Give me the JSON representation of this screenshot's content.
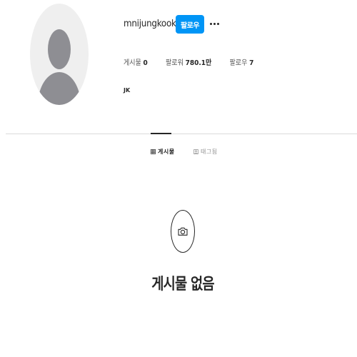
{
  "profile": {
    "username": "mnijungkook",
    "follow_label": "팔로우",
    "more_icon": "more-horizontal-icon",
    "full_name": "JK",
    "avatar_icon": "default-avatar-icon"
  },
  "stats": [
    {
      "label": "게시물",
      "value": "0"
    },
    {
      "label": "팔로워",
      "value": "780.1만"
    },
    {
      "label": "팔로우",
      "value": "7"
    }
  ],
  "tabs": [
    {
      "label": "게시물",
      "icon": "grid-icon",
      "active": true
    },
    {
      "label": "태그됨",
      "icon": "tagged-icon",
      "active": false
    }
  ],
  "empty_state": {
    "icon": "camera-icon",
    "title": "게시물 없음"
  },
  "colors": {
    "accent": "#0095f6",
    "text": "#262626",
    "muted": "#8e8e8e",
    "divider": "#dbdbdb",
    "avatar_bg": "#efefef",
    "avatar_fg": "#8e8e93"
  }
}
